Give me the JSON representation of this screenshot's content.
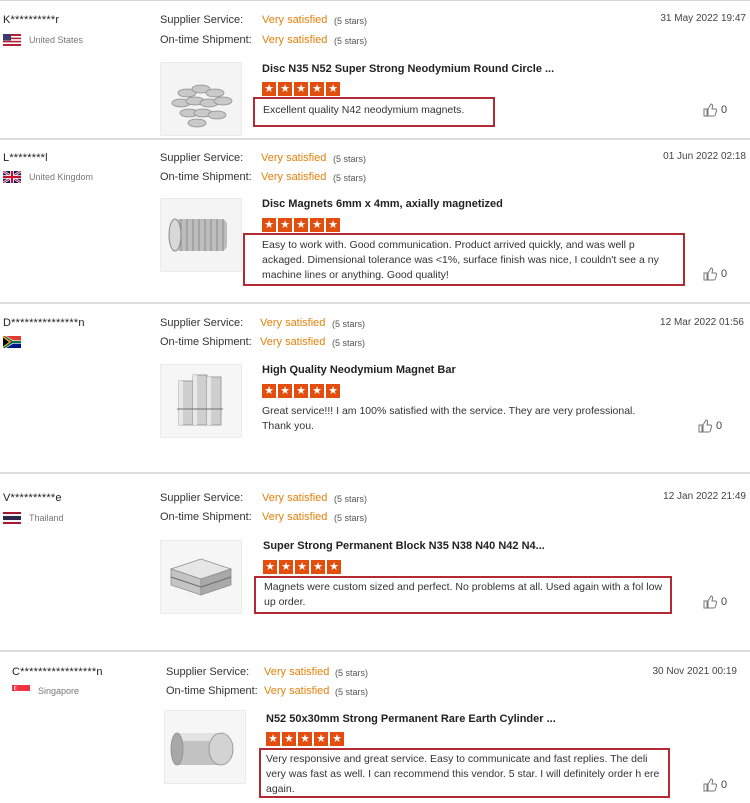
{
  "labels": {
    "supplier_service": "Supplier Service:",
    "ontime_shipment": "On-time Shipment:"
  },
  "colors": {
    "accent_orange": "#e3810b",
    "star_red": "#e34e0e",
    "highlight_box": "#b22a33"
  },
  "reviews": [
    {
      "user": "K**********r",
      "country": "United States",
      "flag_icon": "us-flag-icon",
      "supplier_value": "Very satisfied",
      "supplier_stars": "(5 stars)",
      "shipment_value": "Very satisfied",
      "shipment_stars": "(5 stars)",
      "date": "31 May 2022 19:47",
      "product_title": "Disc N35 N52 Super Strong Neodymium Round Circle ...",
      "rating": 5,
      "feedback": "Excellent quality N42 neodymium magnets.",
      "likes": "0"
    },
    {
      "user": "L********l",
      "country": "United Kingdom",
      "flag_icon": "uk-flag-icon",
      "supplier_value": "Very satisfied",
      "supplier_stars": "(5 stars)",
      "shipment_value": "Very satisfied",
      "shipment_stars": "(5 stars)",
      "date": "01 Jun 2022 02:18",
      "product_title": "Disc Magnets 6mm x 4mm, axially magnetized",
      "rating": 5,
      "feedback": "Easy to work with.  Good communication.  Product arrived quickly, and was well p ackaged.  Dimensional tolerance was <1%, surface finish was nice, I couldn't see a ny machine lines or anything.  Good quality!",
      "likes": "0"
    },
    {
      "user": "D***************n",
      "country": "",
      "flag_icon": "south-africa-flag-icon",
      "supplier_value": "Very satisfied",
      "supplier_stars": "(5 stars)",
      "shipment_value": "Very satisfied",
      "shipment_stars": "(5 stars)",
      "date": "12 Mar 2022 01:56",
      "product_title": "High Quality Neodymium Magnet Bar",
      "rating": 5,
      "feedback": "Great service!!! I am 100% satisfied with the service. They are very professional. Thank you.",
      "likes": "0"
    },
    {
      "user": "V**********e",
      "country": "Thailand",
      "flag_icon": "thailand-flag-icon",
      "supplier_value": "Very satisfied",
      "supplier_stars": "(5 stars)",
      "shipment_value": "Very satisfied",
      "shipment_stars": "(5 stars)",
      "date": "12 Jan 2022 21:49",
      "product_title": "Super Strong Permanent Block N35 N38 N40 N42 N4...",
      "rating": 5,
      "feedback": "Magnets were custom sized and perfect. No problems at all. Used again with a fol low up order.",
      "likes": "0"
    },
    {
      "user": "C*****************n",
      "country": "Singapore",
      "flag_icon": "singapore-flag-icon",
      "supplier_value": "Very satisfied",
      "supplier_stars": "(5 stars)",
      "shipment_value": "Very satisfied",
      "shipment_stars": "(5 stars)",
      "date": "30 Nov 2021 00:19",
      "product_title": "N52 50x30mm Strong Permanent Rare Earth Cylinder ...",
      "rating": 5,
      "feedback": "Very responsive and great service. Easy to communicate and fast replies. The deli very was fast as well. I can recommend this vendor. 5 star. I will definitely order h ere again.",
      "likes": "0"
    }
  ]
}
